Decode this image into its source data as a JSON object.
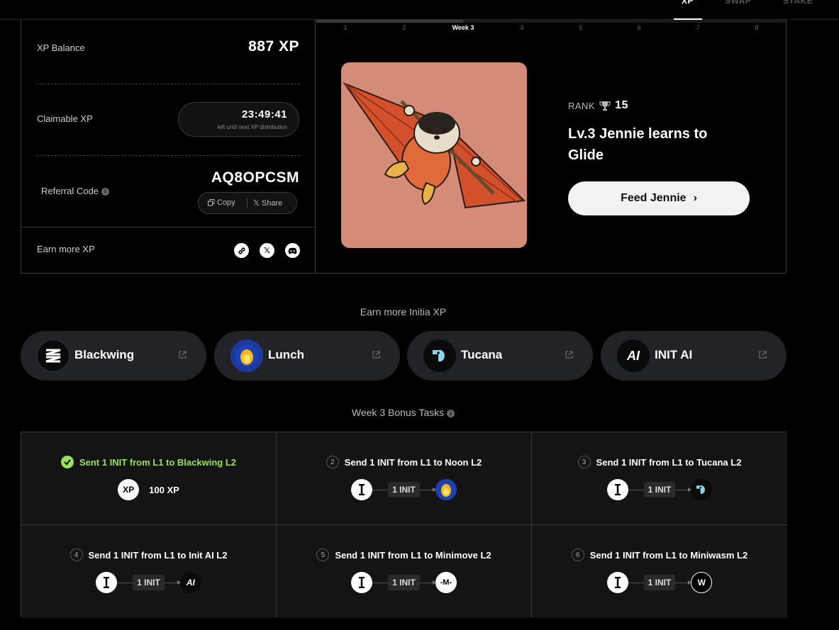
{
  "nav": {
    "tabs": [
      {
        "label": "XP",
        "active": true
      },
      {
        "label": "SWAP",
        "active": false
      },
      {
        "label": "STAKE",
        "active": false
      }
    ]
  },
  "weeks": {
    "labels": [
      "1",
      "2",
      "Week 3",
      "4",
      "5",
      "6",
      "7",
      "8"
    ],
    "current_index": 2
  },
  "xp": {
    "balance_label": "XP Balance",
    "balance_value": "887 XP",
    "claimable_label": "Claimable XP",
    "countdown": "23:49:41",
    "countdown_sub": "left until next XP distribution",
    "referral_label": "Referral Code",
    "info_icon": "i",
    "referral_code": "AQ8OPCSM",
    "copy_label": "Copy",
    "share_label": "Share",
    "earn_more_label": "Earn more XP",
    "social_icons": [
      "link-icon",
      "x-icon",
      "discord-icon"
    ]
  },
  "nft": {
    "rank_label": "RANK",
    "rank_value": "15",
    "title": "Lv.3 Jennie learns to Glide",
    "feed_button": "Feed Jennie",
    "feed_arrow": "›",
    "bg_color": "#d48c78"
  },
  "earn_section": {
    "title": "Earn more Initia XP",
    "apps": [
      {
        "name": "Blackwing",
        "icon": "blackwing-icon"
      },
      {
        "name": "Lunch",
        "icon": "lunch-icon"
      },
      {
        "name": "Tucana",
        "icon": "tucana-icon"
      },
      {
        "name": "INIT AI",
        "icon": "init-ai-icon"
      }
    ]
  },
  "tasks_section": {
    "title": "Week 3 Bonus Tasks",
    "amount": "1 INIT",
    "tasks": [
      {
        "number": "",
        "label": "Sent 1 INIT from L1 to Blackwing L2",
        "done": true,
        "reward": "100 XP",
        "reward_badge": "XP"
      },
      {
        "number": "2",
        "label": "Send 1 INIT from L1 to Noon L2",
        "done": false,
        "dest": "noon-icon"
      },
      {
        "number": "3",
        "label": "Send 1 INIT from L1 to Tucana L2",
        "done": false,
        "dest": "tucana-icon"
      },
      {
        "number": "4",
        "label": "Send 1 INIT from L1 to Init AI L2",
        "done": false,
        "dest": "init-ai-icon",
        "dest_text": "AI"
      },
      {
        "number": "5",
        "label": "Send 1 INIT from L1 to Minimove L2",
        "done": false,
        "dest": "minimove-icon",
        "dest_text": "-M-"
      },
      {
        "number": "6",
        "label": "Send 1 INIT from L1 to Miniwasm L2",
        "done": false,
        "dest": "miniwasm-icon",
        "dest_text": "W"
      }
    ]
  },
  "colors": {
    "accent_done": "#9be15d",
    "panel_border": "#3a3a3a"
  }
}
